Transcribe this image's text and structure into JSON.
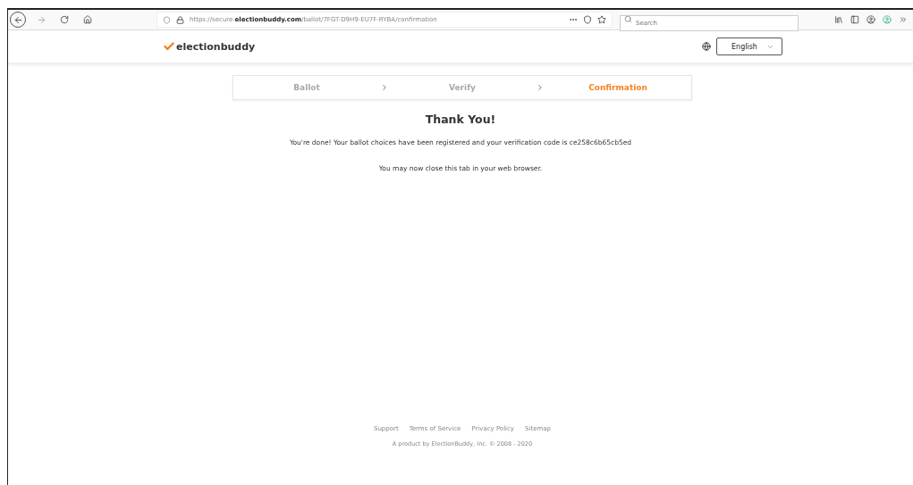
{
  "browser": {
    "url": "https://secure.**electionbuddy.com**/ballot/7FGT-D9H9-EU7F-RYBA/confirmation",
    "search_placeholder": "Search"
  },
  "header": {
    "logo": "electionbuddy",
    "language": "English"
  },
  "steps": [
    {
      "label": "Ballot",
      "selected": false
    },
    {
      "label": "Verify",
      "selected": false
    },
    {
      "label": "Confirmation",
      "selected": true
    }
  ],
  "title": "Thank You!",
  "message": "You're done! Your ballot choices have been registered and your verification code is ce258c6b65cb5ed",
  "note": "You may now close this tab in your web browser.",
  "footer": {
    "links": [
      "Support",
      "Terms of Service",
      "Privacy Policy",
      "Sitemap"
    ],
    "copyright": "A product by ElectionBuddy, Inc. © 2008 - 2020"
  }
}
